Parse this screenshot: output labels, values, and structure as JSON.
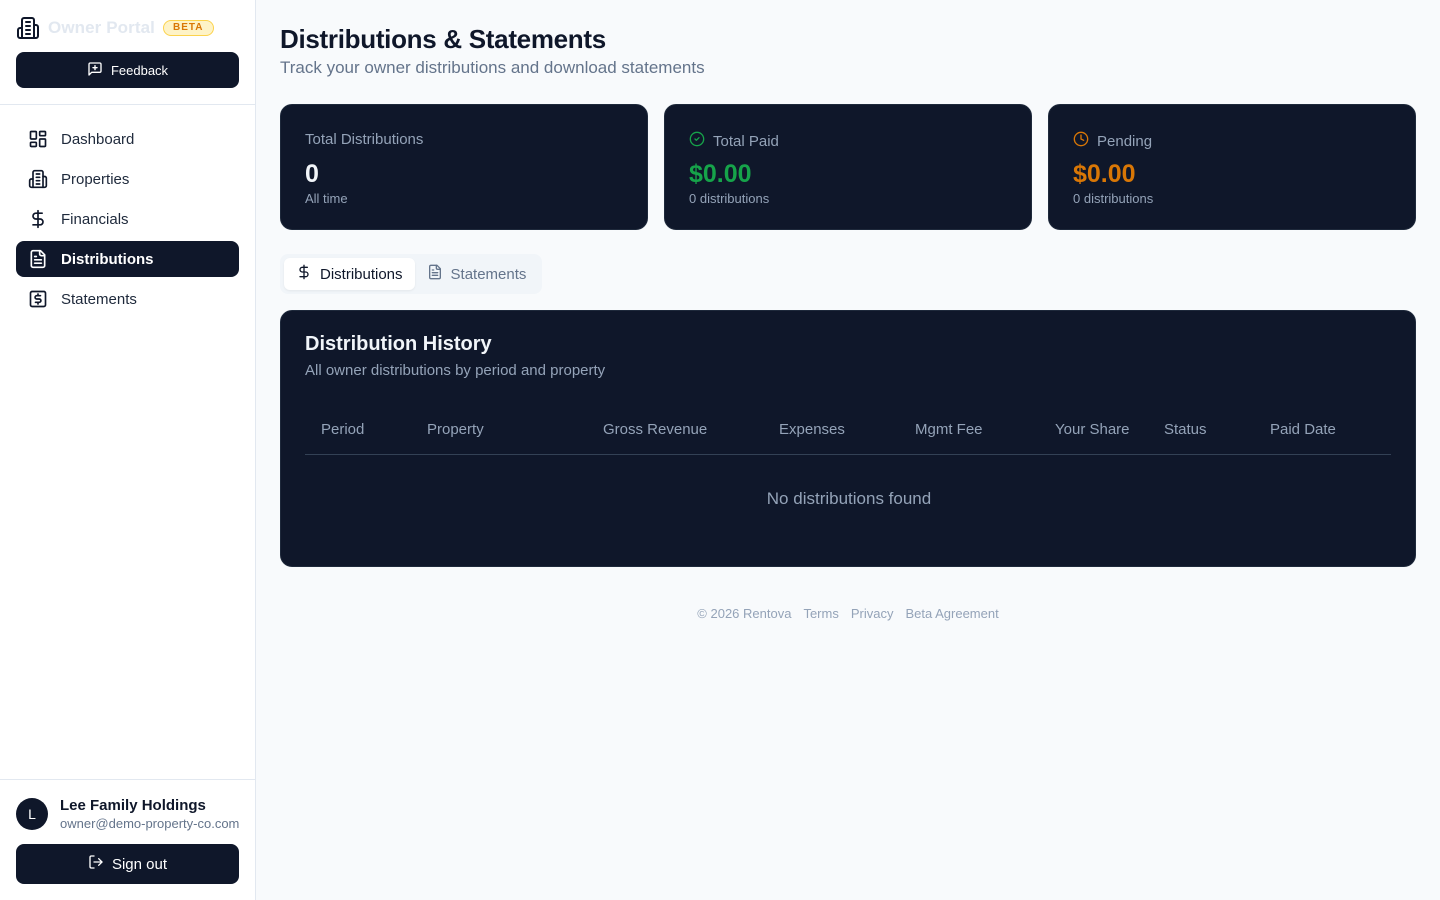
{
  "sidebar": {
    "brand": "Owner Portal",
    "badge": "BETA",
    "feedback_label": "Feedback",
    "nav": [
      {
        "label": "Dashboard",
        "icon": "layout-dashboard-icon"
      },
      {
        "label": "Properties",
        "icon": "building-icon"
      },
      {
        "label": "Financials",
        "icon": "dollar-sign-icon"
      },
      {
        "label": "Distributions",
        "icon": "file-text-icon",
        "active": true
      },
      {
        "label": "Statements",
        "icon": "receipt-icon"
      }
    ],
    "user": {
      "initial": "L",
      "name": "Lee Family Holdings",
      "email": "owner@demo-property-co.com"
    },
    "signout_label": "Sign out"
  },
  "header": {
    "title": "Distributions & Statements",
    "subtitle": "Track your owner distributions and download statements"
  },
  "stats": [
    {
      "label": "Total Distributions",
      "value": "0",
      "sub": "All time",
      "color": "#f1f5f9"
    },
    {
      "label": "Total Paid",
      "value": "$0.00",
      "sub": "0 distributions",
      "color": "#16a34a",
      "icon": "check-circle-icon"
    },
    {
      "label": "Pending",
      "value": "$0.00",
      "sub": "0 distributions",
      "color": "#d97706",
      "icon": "clock-icon"
    }
  ],
  "tabs": [
    {
      "label": "Distributions",
      "icon": "dollar-sign-icon",
      "active": true
    },
    {
      "label": "Statements",
      "icon": "file-text-icon"
    }
  ],
  "history": {
    "title": "Distribution History",
    "subtitle": "All owner distributions by period and property",
    "columns": [
      "Period",
      "Property",
      "Gross Revenue",
      "Expenses",
      "Mgmt Fee",
      "Your Share",
      "Status",
      "Paid Date"
    ],
    "empty_message": "No distributions found"
  },
  "footer": {
    "copyright": "© 2026 Rentova",
    "links": [
      "Terms",
      "Privacy",
      "Beta Agreement"
    ]
  }
}
